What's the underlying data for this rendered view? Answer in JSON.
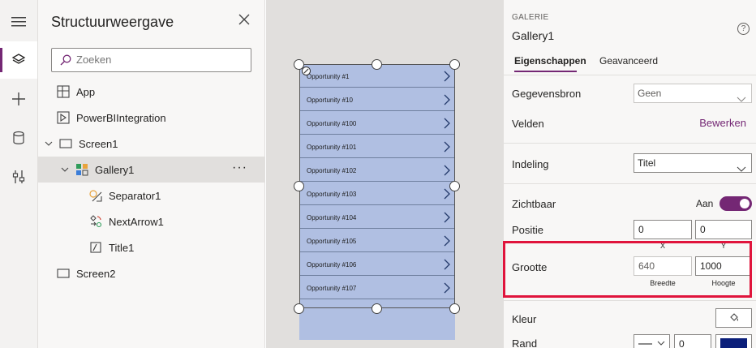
{
  "rail": {
    "items": [
      "menu-icon",
      "layers-icon",
      "add-icon",
      "data-icon",
      "tools-icon"
    ],
    "accent": "#742774"
  },
  "tree": {
    "title": "Structuurweergave",
    "search_placeholder": "Zoeken",
    "nodes": [
      {
        "label": "App",
        "icon": "app-icon"
      },
      {
        "label": "PowerBIIntegration",
        "icon": "component-icon"
      },
      {
        "label": "Screen1",
        "icon": "screen-icon"
      },
      {
        "label": "Gallery1",
        "icon": "gallery-icon"
      },
      {
        "label": "Separator1",
        "icon": "separator-icon"
      },
      {
        "label": "NextArrow1",
        "icon": "arrow-icon"
      },
      {
        "label": "Title1",
        "icon": "label-icon"
      },
      {
        "label": "Screen2",
        "icon": "screen-icon"
      }
    ],
    "more": "···"
  },
  "gallery": {
    "items": [
      "Opportunity #1",
      "Opportunity #10",
      "Opportunity #100",
      "Opportunity #101",
      "Opportunity #102",
      "Opportunity #103",
      "Opportunity #104",
      "Opportunity #105",
      "Opportunity #106",
      "Opportunity #107"
    ],
    "fill": "#b0bfe2"
  },
  "props": {
    "kind": "GALERIE",
    "name": "Gallery1",
    "help": "?",
    "tabs": [
      "Eigenschappen",
      "Geavanceerd"
    ],
    "gegevensbron": {
      "label": "Gegevensbron",
      "value": "Geen"
    },
    "velden": {
      "label": "Velden",
      "link": "Bewerken"
    },
    "indeling": {
      "label": "Indeling",
      "value": "Titel"
    },
    "zichtbaar": {
      "label": "Zichtbaar",
      "value": "Aan"
    },
    "positie": {
      "label": "Positie",
      "x": "0",
      "y": "0",
      "x_caption": "X",
      "y_caption": "Y"
    },
    "grootte": {
      "label": "Grootte",
      "width": "640",
      "height": "1000",
      "width_caption": "Breedte",
      "height_caption": "Hoogte"
    },
    "kleur": {
      "label": "Kleur"
    },
    "rand": {
      "label": "Rand",
      "thickness": "0",
      "color": "#0b1f7a"
    },
    "highlight_color": "#e0143c"
  }
}
